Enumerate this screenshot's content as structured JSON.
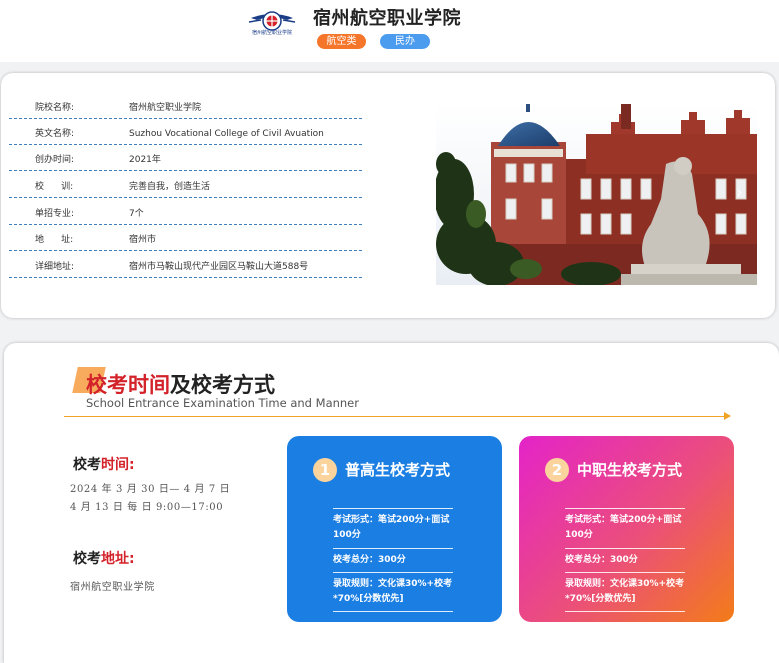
{
  "header": {
    "logo_text": "宿州航空职业学院",
    "school_name": "宿州航空职业学院",
    "tags": [
      "航空类",
      "民办"
    ]
  },
  "info": {
    "rows": [
      {
        "label": "院校名称:",
        "value": "宿州航空职业学院"
      },
      {
        "label": "英文名称:",
        "value": "Suzhou Vocational College of Civil Avuation"
      },
      {
        "label": "创办时间:",
        "value": "2021年"
      },
      {
        "label": "校      训:",
        "value": "完善自我，创造生活"
      },
      {
        "label": "单招专业:",
        "value": "7个"
      },
      {
        "label": "地      址:",
        "value": "宿州市"
      },
      {
        "label": "详细地址:",
        "value": "宿州市马鞍山现代产业园区马鞍山大道588号"
      }
    ],
    "photo_next_icon": "chevron-right-icon"
  },
  "exam": {
    "title_red": "校考时间",
    "title_dark": "及校考方式",
    "subtitle": "School Entrance Examination Time and Manner",
    "time_heading_dark": "校考",
    "time_heading_red": "时间:",
    "time_line1": "2024 年 3 月 30 日— 4 月 7 日",
    "time_line2": "4 月 13 日 每 日 9:00—17:00",
    "place_heading_dark": "校考",
    "place_heading_red": "地址:",
    "place_text": "宿州航空职业学院",
    "methods": [
      {
        "number": "1",
        "title": "普高生校考方式",
        "items": [
          "考试形式：笔试200分+面试100分",
          "校考总分：300分",
          "录取规则：文化课30%+校考*70%[分数优先]"
        ]
      },
      {
        "number": "2",
        "title": "中职生校考方式",
        "items": [
          "考试形式：笔试200分+面试100分",
          "校考总分：300分",
          "录取规则：文化课30%+校考*70%[分数优先]"
        ]
      }
    ]
  },
  "colors": {
    "accent_red": "#d3222a",
    "tag_orange": "#f5762b",
    "tag_blue": "#4b9bef",
    "box_blue": "#1a7ee3",
    "divider": "#f0a325"
  }
}
